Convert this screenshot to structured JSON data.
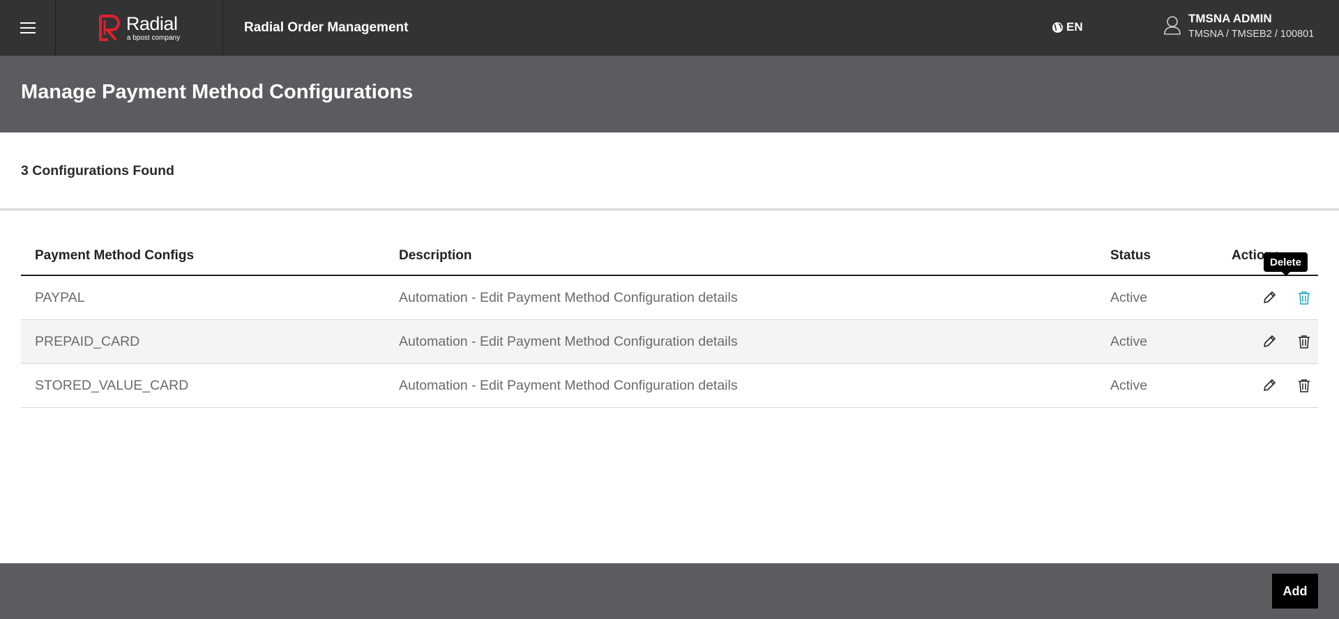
{
  "header": {
    "brand_name": "Radial",
    "brand_sub": "a bpost company",
    "app_title": "Radial Order Management",
    "language": "EN",
    "user_name": "TMSNA ADMIN",
    "user_org": "TMSNA / TMSEB2 / 100801",
    "brand_color": "#e31e2d"
  },
  "page": {
    "title": "Manage Payment Method Configurations",
    "count_text": "3 Configurations Found"
  },
  "table": {
    "columns": [
      "Payment Method Configs",
      "Description",
      "Status",
      "Actions"
    ],
    "rows": [
      {
        "config": "PAYPAL",
        "description": "Automation - Edit Payment Method Configuration details",
        "status": "Active"
      },
      {
        "config": "PREPAID_CARD",
        "description": "Automation - Edit Payment Method Configuration details",
        "status": "Active"
      },
      {
        "config": "STORED_VALUE_CARD",
        "description": "Automation - Edit Payment Method Configuration details",
        "status": "Active"
      }
    ]
  },
  "tooltip": {
    "text": "Delete"
  },
  "footer": {
    "add_label": "Add"
  },
  "icons": {
    "menu": "hamburger-icon",
    "language": "globe-icon",
    "user": "user-icon",
    "edit": "pencil-icon",
    "delete": "trash-icon"
  },
  "colors": {
    "topbar": "#333333",
    "band": "#5b5b60",
    "hover_accent": "#1aa6c8"
  }
}
